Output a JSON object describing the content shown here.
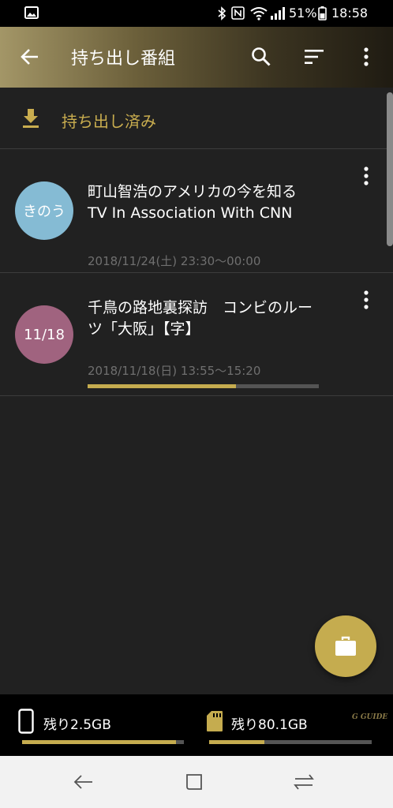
{
  "status_bar": {
    "battery": "51%",
    "time": "18:58",
    "icons": [
      "gallery-icon",
      "bluetooth-icon",
      "nfc-icon",
      "wifi-icon",
      "signal-icon",
      "battery-icon"
    ]
  },
  "app_bar": {
    "title": "持ち出し番組",
    "icons": [
      "back-arrow-icon",
      "search-icon",
      "sort-icon",
      "more-vert-icon"
    ]
  },
  "downloaded_section": {
    "label": "持ち出し済み",
    "icon": "download-icon"
  },
  "programs": [
    {
      "badge": "きのう",
      "badge_color": "#85bbd4",
      "title_line1": "町山智浩のアメリカの今を知る",
      "title_line2": "TV In Association With CNN",
      "datetime": "2018/11/24(土) 23:30～00:00"
    },
    {
      "badge": "11/18",
      "badge_color": "#a0637f",
      "title_line1": "千鳥の路地裏探訪　コンビのルー",
      "title_line2": "ツ「大阪」【字】",
      "datetime": "2018/11/18(日) 13:55～15:20",
      "progress": 0.64
    }
  ],
  "fab": {
    "icon": "briefcase-icon"
  },
  "storage": {
    "device": {
      "label": "残り2.5GB",
      "icon": "phone-icon",
      "used_fraction": 0.95
    },
    "sd": {
      "label": "残り80.1GB",
      "icon": "sd-card-icon",
      "used_fraction": 0.34
    },
    "logo": "G GUIDE"
  },
  "nav_bar": {
    "icons": [
      "nav-back-icon",
      "recents-icon",
      "nav-switch-icon"
    ]
  },
  "colors": {
    "accent": "#c5ac4f",
    "background": "#212121",
    "badge_yesterday": "#85bbd4",
    "badge_date": "#a0637f"
  }
}
